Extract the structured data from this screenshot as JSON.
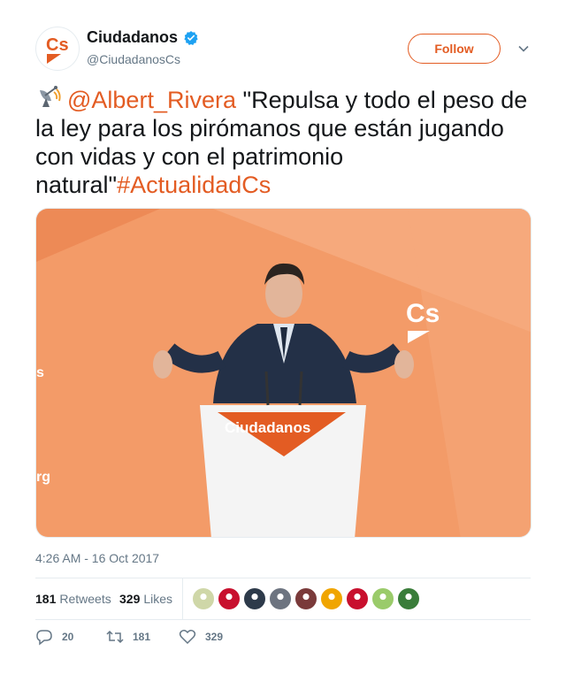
{
  "account": {
    "display_name": "Ciudadanos",
    "handle": "@CiudadanosCs",
    "avatar_text": "Cs",
    "verified": true
  },
  "follow_label": "Follow",
  "tweet": {
    "icon": "satellite-antenna-emoji",
    "mention": "@Albert_Rivera",
    "body": " \"Repulsa y todo el peso de la ley para los pirómanos que están jugando con vidas y con el patrimonio natural\"",
    "hashtag": "#ActualidadCs"
  },
  "media": {
    "podium_text": "Ciudadanos",
    "wall_logo": "Cs",
    "wall_edge_s": "s",
    "wall_edge_rg": "rg"
  },
  "timestamp": "4:26 AM - 16 Oct 2017",
  "stats": {
    "retweets_count": "181",
    "retweets_label": "Retweets",
    "likes_count": "329",
    "likes_label": "Likes",
    "likers": [
      "#cfd7a8",
      "#c8102e",
      "#2d3a4a",
      "#6d7480",
      "#7a3a3a",
      "#f0a500",
      "#c8102e",
      "#9acb6a",
      "#3a7d3a"
    ]
  },
  "actions": {
    "reply_count": "20",
    "retweet_count": "181",
    "like_count": "329"
  },
  "colors": {
    "brand": "#e35c23",
    "text": "#14171a",
    "muted": "#657786",
    "verified": "#1da1f2"
  }
}
